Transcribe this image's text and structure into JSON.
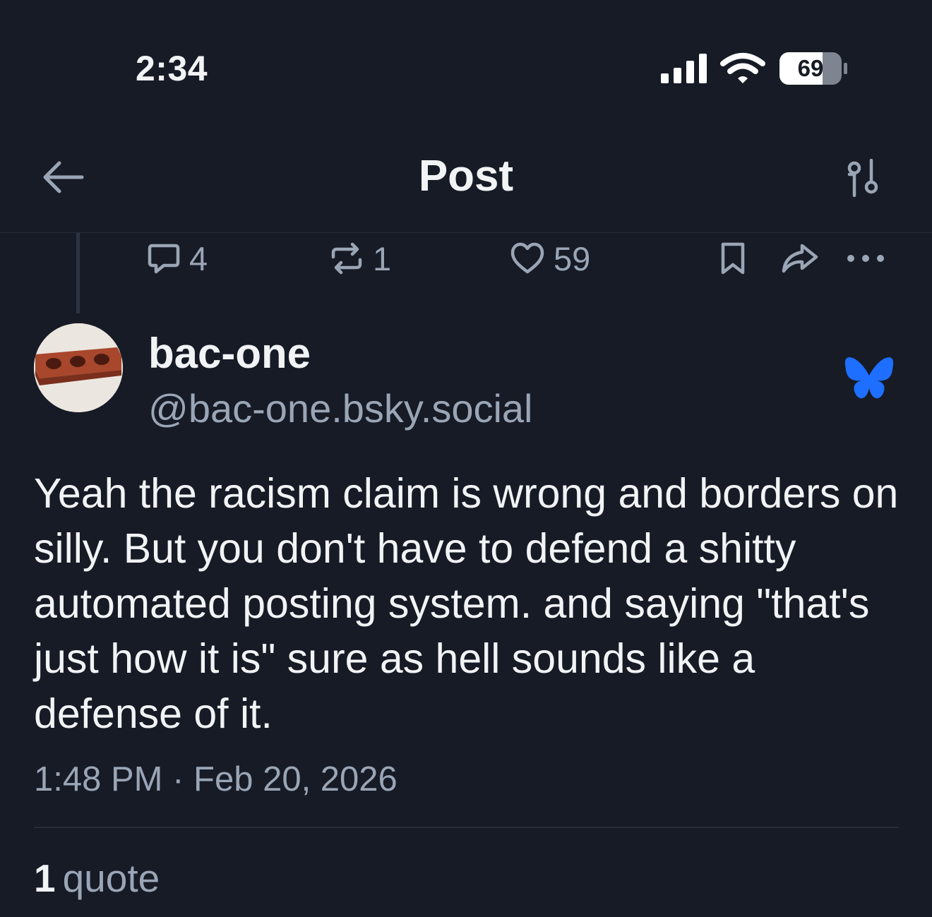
{
  "status_bar": {
    "time": "2:34",
    "battery": "69"
  },
  "header": {
    "title": "Post",
    "back_icon": "arrow-left-icon",
    "filter_icon": "sliders-icon"
  },
  "parent_actions": {
    "reply_count": "4",
    "repost_count": "1",
    "like_count": "59"
  },
  "post": {
    "display_name": "bac-one",
    "handle": "@bac-one.bsky.social",
    "text": "Yeah the racism claim is wrong and borders on silly. But you don't have to defend a shitty automated posting system. and saying \"that's just how it is\" sure as hell sounds like a defense of it.",
    "timestamp": "1:48 PM · Feb 20, 2026",
    "quote_count": "1",
    "quote_label": "quote"
  },
  "colors": {
    "background": "#161b26",
    "text": "#f1f3f5",
    "muted": "#9aa5b5",
    "bluesky_blue": "#1e6fff"
  }
}
